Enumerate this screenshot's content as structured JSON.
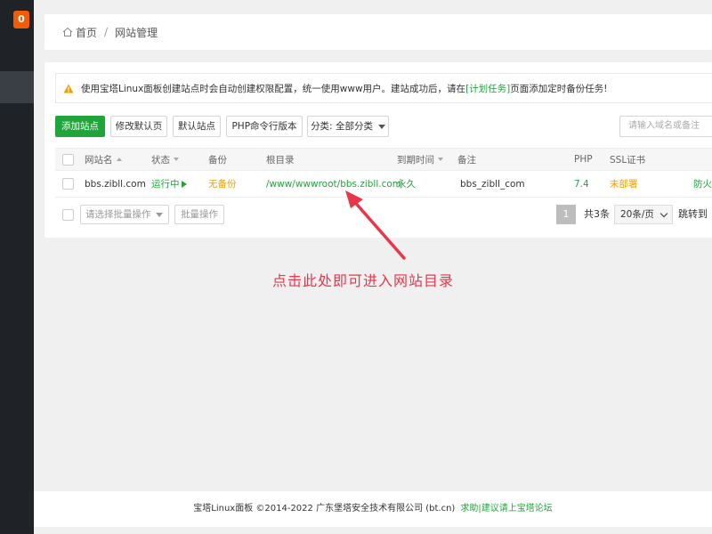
{
  "sidebar": {
    "badge": "0"
  },
  "breadcrumb": {
    "home": "首页",
    "separator": "/",
    "current": "网站管理"
  },
  "notice": {
    "before": "使用宝塔Linux面板创建站点时会自动创建权限配置，统一使用www用户。建站成功后，请在",
    "link": "[计划任务]",
    "after": "页面添加定时备份任务!"
  },
  "toolbar": {
    "add_site": "添加站点",
    "edit_default_page": "修改默认页",
    "default_site": "默认站点",
    "php_cli_version": "PHP命令行版本",
    "category_select": "分类: 全部分类",
    "search_placeholder": "请输入域名或备注"
  },
  "table": {
    "headers": {
      "site_name": "网站名",
      "status": "状态",
      "backup": "备份",
      "root_dir": "根目录",
      "expire": "到期时间",
      "remark": "备注",
      "php": "PHP",
      "ssl": "SSL证书"
    },
    "rows": [
      {
        "site_name": "bbs.zibll.com",
        "status": "运行中",
        "backup": "无备份",
        "root_dir": "/www/wwwroot/bbs.zibll.com",
        "expire": "永久",
        "remark": "bbs_zibll_com",
        "php": "7.4",
        "ssl": "未部署",
        "action": "防火"
      }
    ]
  },
  "bulk": {
    "select_placeholder": "请选择批量操作",
    "button": "批量操作"
  },
  "pager": {
    "current_page": "1",
    "total": "共3条",
    "page_size": "20条/页",
    "jump": "跳转到"
  },
  "annotation": {
    "text": "点击此处即可进入网站目录"
  },
  "footer": {
    "copyright": "宝塔Linux面板 ©2014-2022 广东堡塔安全技术有限公司 (bt.cn)",
    "help": "求助|建议请上宝塔论坛"
  },
  "colors": {
    "brand_green": "#20a53a",
    "warning_orange": "#f0a000",
    "annotation_red": "#e8364b",
    "sidebar_bg": "#1f2328"
  }
}
